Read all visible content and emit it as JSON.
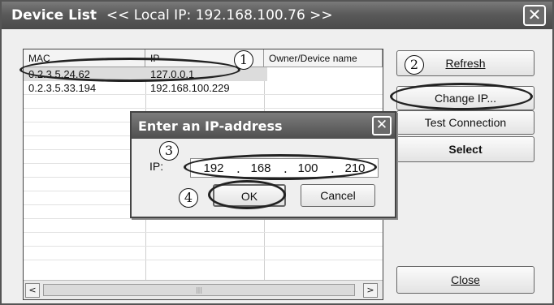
{
  "window": {
    "title": "Device List",
    "title_ip": "<< Local IP: 192.168.100.76 >>",
    "close_glyph": "✕"
  },
  "list": {
    "columns": [
      "MAC",
      "IP",
      "Owner/Device name"
    ],
    "rows": [
      {
        "mac": "0.2.3.5.24.62",
        "ip": "127.0.0.1",
        "owner": ""
      },
      {
        "mac": "0.2.3.5.33.194",
        "ip": "192.168.100.229",
        "owner": ""
      }
    ],
    "scroll_left": "<",
    "scroll_right": ">",
    "thumb_grip": "|||"
  },
  "buttons": {
    "refresh": "Refresh",
    "change_ip": "Change IP...",
    "test_connection": "Test Connection",
    "select": "Select",
    "close": "Close"
  },
  "dialog": {
    "title": "Enter an IP-address",
    "close_glyph": "✕",
    "ip_label": "IP:",
    "octets": [
      "192",
      "168",
      "100",
      "210"
    ],
    "separator": ".",
    "ok": "OK",
    "cancel": "Cancel"
  },
  "annotations": {
    "n1": "1",
    "n2": "2",
    "n3": "3",
    "n4": "4"
  }
}
